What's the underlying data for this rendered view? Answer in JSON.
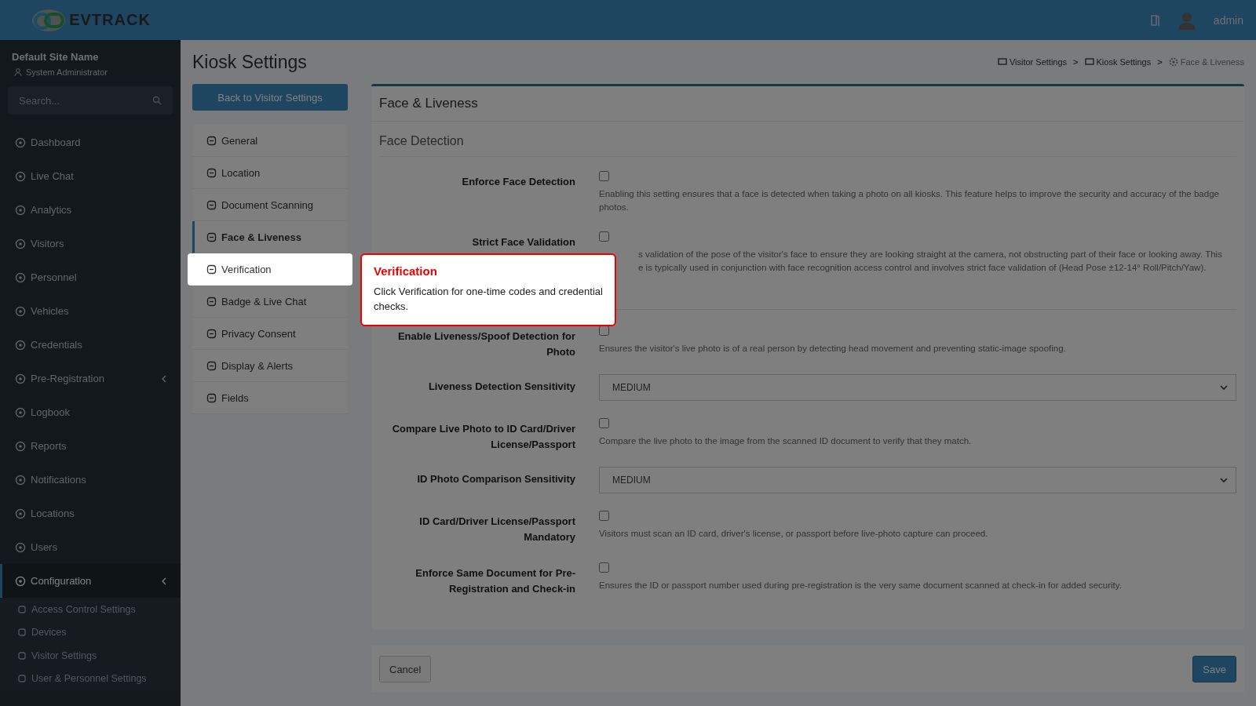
{
  "header": {
    "logo_text": "EVTRACK",
    "user": "admin"
  },
  "sidebar": {
    "site": "Default Site Name",
    "role": "System Administrator",
    "search": {
      "placeholder": "Search..."
    },
    "items": [
      {
        "label": "Dashboard",
        "selected": false,
        "expandable": false
      },
      {
        "label": "Live Chat",
        "selected": false,
        "expandable": false
      },
      {
        "label": "Analytics",
        "selected": false,
        "expandable": false
      },
      {
        "label": "Visitors",
        "selected": false,
        "expandable": false
      },
      {
        "label": "Personnel",
        "selected": false,
        "expandable": false
      },
      {
        "label": "Vehicles",
        "selected": false,
        "expandable": false
      },
      {
        "label": "Credentials",
        "selected": false,
        "expandable": false
      },
      {
        "label": "Pre-Registration",
        "selected": false,
        "expandable": true
      },
      {
        "label": "Logbook",
        "selected": false,
        "expandable": false
      },
      {
        "label": "Reports",
        "selected": false,
        "expandable": false
      },
      {
        "label": "Notifications",
        "selected": false,
        "expandable": false
      },
      {
        "label": "Locations",
        "selected": false,
        "expandable": false
      },
      {
        "label": "Users",
        "selected": false,
        "expandable": false
      },
      {
        "label": "Configuration",
        "selected": true,
        "expandable": true,
        "children": [
          {
            "label": "Access Control Settings"
          },
          {
            "label": "Devices"
          },
          {
            "label": "Visitor Settings"
          },
          {
            "label": "User & Personnel Settings"
          }
        ]
      }
    ]
  },
  "page": {
    "title": "Kiosk Settings",
    "back_button": "Back to Visitor Settings",
    "breadcrumb": [
      {
        "kind": "link",
        "label": "Visitor Settings"
      },
      {
        "kind": "sep",
        "label": ">"
      },
      {
        "kind": "link",
        "label": "Kiosk Settings"
      },
      {
        "kind": "sep",
        "label": ">"
      },
      {
        "kind": "current",
        "label": "Face & Liveness"
      }
    ]
  },
  "tabs": [
    {
      "label": "General",
      "selected": false,
      "highlighted": false
    },
    {
      "label": "Location",
      "selected": false,
      "highlighted": false
    },
    {
      "label": "Document Scanning",
      "selected": false,
      "highlighted": false
    },
    {
      "label": "Face & Liveness",
      "selected": true,
      "highlighted": false
    },
    {
      "label": "Verification",
      "selected": false,
      "highlighted": true
    },
    {
      "label": "Badge & Live Chat",
      "selected": false,
      "highlighted": false
    },
    {
      "label": "Privacy Consent",
      "selected": false,
      "highlighted": false
    },
    {
      "label": "Display & Alerts",
      "selected": false,
      "highlighted": false
    },
    {
      "label": "Fields",
      "selected": false,
      "highlighted": false
    }
  ],
  "tour_tip": {
    "title": "Verification",
    "text": "Click Verification for one-time codes and credential checks."
  },
  "card": {
    "title": "Face & Liveness",
    "section": "Face Detection",
    "groups": [
      [
        {
          "kind": "checkbox",
          "label": "Enforce Face Detection",
          "checked": false,
          "description": "Enabling this setting ensures that a face is detected when taking a photo on all kiosks. This feature helps to improve the security and accuracy of the badge photos."
        },
        {
          "kind": "partial",
          "label": "Strict Face Validation",
          "checked": false,
          "description_lines": [
            "s validation of the pose of the visitor's face to ensure they are looking straight at the camera, not obstructing part of their face or looking away. This",
            "e is typically used in conjunction with face recognition access control and involves strict face validation of (Head Pose ±12-14° Roll/Pitch/Yaw)."
          ]
        }
      ],
      [
        {
          "kind": "checkbox",
          "label": "Enable Liveness/Spoof Detection for Photo",
          "checked": false,
          "description": "Ensures the visitor's live photo is of a real person by detecting head movement and preventing static-image spoofing."
        },
        {
          "kind": "select",
          "label": "Liveness Detection Sensitivity",
          "value": "MEDIUM"
        },
        {
          "kind": "checkbox",
          "label": "Compare Live Photo to ID Card/Driver License/Passport",
          "checked": false,
          "description": "Compare the live photo to the image from the scanned ID document to verify that they match."
        },
        {
          "kind": "select",
          "label": "ID Photo Comparison Sensitivity",
          "value": "MEDIUM"
        },
        {
          "kind": "checkbox",
          "label": "ID Card/Driver License/Passport Mandatory",
          "checked": false,
          "description": "Visitors must scan an ID card, driver's license, or passport before live-photo capture can proceed."
        },
        {
          "kind": "checkbox",
          "label": "Enforce Same Document for Pre-Registration and Check-in",
          "checked": false,
          "description": "Ensures the ID or passport number used during pre-registration is the very same document scanned at check-in for added security."
        }
      ]
    ]
  },
  "footer": {
    "cancel": "Cancel",
    "save": "Save"
  }
}
